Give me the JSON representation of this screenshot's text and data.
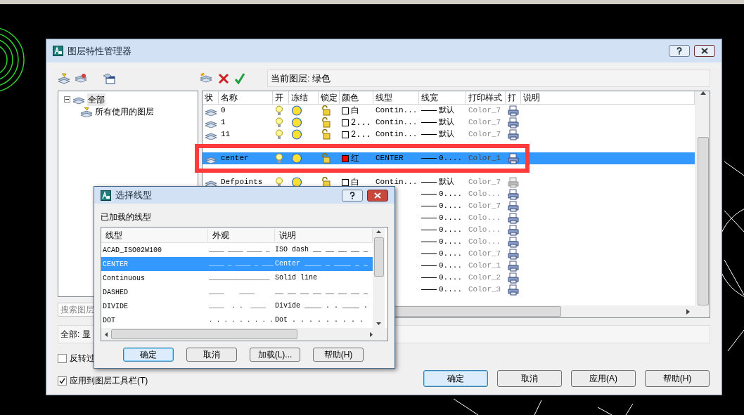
{
  "window": {
    "title": "图层特性管理器"
  },
  "current_layer": "当前图层: 绿色",
  "tree": [
    {
      "label": "全部",
      "expanded": true,
      "selected": true,
      "children": [
        {
          "label": "所有使用的图层",
          "selected": false
        }
      ]
    }
  ],
  "search": {
    "placeholder": "搜索图层"
  },
  "status_text": "全部: 显",
  "options": [
    {
      "label": "反转过",
      "checked": false
    },
    {
      "label": "应用到图层工具栏(T)",
      "checked": true
    }
  ],
  "buttons": [
    {
      "label": "确定",
      "default": true
    },
    {
      "label": "取消",
      "default": false
    },
    {
      "label": "应用(A)",
      "default": false
    },
    {
      "label": "帮助(H)",
      "default": false
    }
  ],
  "table": {
    "columns": [
      "状",
      "名称",
      "开",
      "冻结",
      "锁定",
      "颜色",
      "线型",
      "线宽",
      "打印样式",
      "打",
      "说明"
    ],
    "rows": [
      {
        "kind": "full",
        "name": "0",
        "color": "#ffffff",
        "color_name": "白",
        "linetype": "Contin...",
        "lineweight": "默认",
        "plot_style": "Color_7",
        "plot": true,
        "selected": false
      },
      {
        "kind": "full",
        "name": "1",
        "color": "#ffffff",
        "color_name": "2...",
        "linetype": "Contin...",
        "lineweight": "默认",
        "plot_style": "Color_7",
        "plot": true,
        "selected": false
      },
      {
        "kind": "full",
        "name": "11",
        "color": "#ffffff",
        "color_name": "2...",
        "linetype": "Contin...",
        "lineweight": "默认",
        "plot_style": "Color_7",
        "plot": true,
        "selected": false
      },
      {
        "kind": "hidden",
        "selected": false
      },
      {
        "kind": "full",
        "name": "center",
        "color": "#ff0000",
        "color_name": "红",
        "linetype": "CENTER",
        "lineweight": "0....",
        "plot_style": "Color_1",
        "plot": true,
        "selected": true
      },
      {
        "kind": "hidden",
        "selected": false
      },
      {
        "kind": "full",
        "name": "Defpoints",
        "color": "#ffffff",
        "color_name": "白",
        "linetype": "Contin...",
        "lineweight": "默认",
        "plot_style": "Color_7",
        "plot": false,
        "selected": false
      },
      {
        "kind": "partial",
        "lineweight": "0....",
        "plot_style": "Colo...",
        "plot": true,
        "selected": false
      },
      {
        "kind": "partial",
        "lineweight": "0....",
        "plot_style": "Color_7",
        "plot": true,
        "selected": false
      },
      {
        "kind": "partial",
        "lineweight": "0....",
        "plot_style": "Colo...",
        "plot": true,
        "selected": false
      },
      {
        "kind": "partial",
        "lineweight": "0....",
        "plot_style": "Colo...",
        "plot": true,
        "selected": false
      },
      {
        "kind": "partial",
        "lineweight": "0....",
        "plot_style": "Colo...",
        "plot": true,
        "selected": false
      },
      {
        "kind": "partial",
        "lineweight": "0....",
        "plot_style": "Color_7",
        "plot": true,
        "selected": false
      },
      {
        "kind": "partial",
        "lineweight": "0....",
        "plot_style": "Color_1",
        "plot": true,
        "selected": false
      },
      {
        "kind": "partial",
        "lineweight": "0....",
        "plot_style": "Color_2",
        "plot": true,
        "selected": false
      },
      {
        "kind": "partial",
        "lineweight": "0....",
        "plot_style": "Color_3",
        "plot": true,
        "selected": false
      }
    ]
  },
  "linetype_dialog": {
    "title": "选择线型",
    "label": "已加载的线型",
    "columns": [
      "线型",
      "外观",
      "说明"
    ],
    "rows": [
      {
        "name": "ACAD_ISO02W100",
        "appearance": "____ ____ ____ _",
        "description": "ISO dash __ __ __ __ _",
        "selected": false
      },
      {
        "name": "CENTER",
        "appearance": "____ _ ____ _ ___",
        "description": "Center ____ _ ____ _ _",
        "selected": true
      },
      {
        "name": "Continuous",
        "appearance": "________________",
        "description": "Solid line",
        "selected": false
      },
      {
        "name": "DASHED",
        "appearance": "____    ____",
        "description": "__ __ __ __ __ __ __ _",
        "selected": false
      },
      {
        "name": "DIVIDE",
        "appearance": "____  . .  ____",
        "description": "Divide ____ . . ____ .",
        "selected": false
      },
      {
        "name": "DOT",
        "appearance": ". . . . . . . . .",
        "description": "Dot . . . . . . . . .",
        "selected": false
      }
    ],
    "buttons": [
      {
        "label": "确定",
        "default": true
      },
      {
        "label": "取消",
        "default": false
      },
      {
        "label": "加载(L)...",
        "default": false
      },
      {
        "label": "帮助(H)",
        "default": false
      }
    ]
  }
}
